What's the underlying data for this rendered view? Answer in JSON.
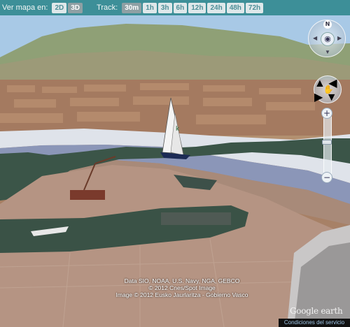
{
  "toolbar": {
    "map_label": "Ver mapa en:",
    "map_modes": [
      {
        "label": "2D",
        "active": false
      },
      {
        "label": "3D",
        "active": true
      }
    ],
    "track_label": "Track:",
    "track_ranges": [
      {
        "label": "30m",
        "active": true
      },
      {
        "label": "1h",
        "active": false
      },
      {
        "label": "3h",
        "active": false
      },
      {
        "label": "6h",
        "active": false
      },
      {
        "label": "12h",
        "active": false
      },
      {
        "label": "24h",
        "active": false
      },
      {
        "label": "48h",
        "active": false
      },
      {
        "label": "72h",
        "active": false
      }
    ]
  },
  "navigation": {
    "north_label": "N",
    "zoom_in": "+",
    "zoom_out": "−"
  },
  "attribution": {
    "line1": "Data SIO, NOAA, U.S. Navy, NGA, GEBCO",
    "line2": "© 2012 Cnes/Spot Image",
    "line3": "Image © 2012 Eusko Jaurlaritza - Gobierno Vasco"
  },
  "logo_text": "Google earth",
  "terms_link": "Condiciones del servicio",
  "colors": {
    "toolbar_bg": "#3d8f98",
    "button_bg": "#dfe8ea",
    "button_active_bg": "#8fa0a4",
    "river": "#3b5548"
  }
}
